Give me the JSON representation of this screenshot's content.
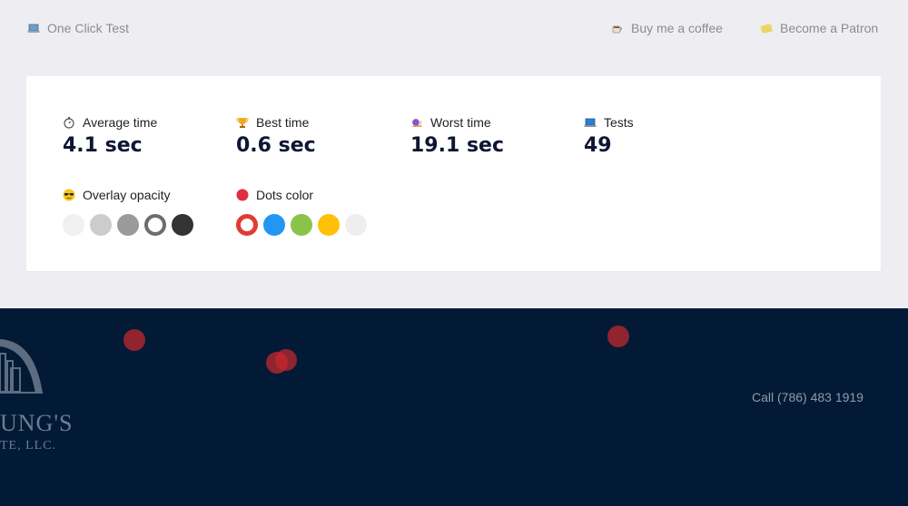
{
  "topbar": {
    "brand": {
      "label": "One Click Test",
      "icon": "laptop-icon"
    },
    "coffee": {
      "label": "Buy me a coffee",
      "icon": "coffee-icon"
    },
    "patron": {
      "label": "Become a Patron",
      "icon": "money-icon"
    }
  },
  "stats": {
    "average": {
      "label": "Average time",
      "value": "4.1 sec",
      "icon": "stopwatch-icon"
    },
    "best": {
      "label": "Best time",
      "value": "0.6 sec",
      "icon": "trophy-icon"
    },
    "worst": {
      "label": "Worst time",
      "value": "19.1 sec",
      "icon": "snail-icon"
    },
    "tests": {
      "label": "Tests",
      "value": "49",
      "icon": "laptop-icon"
    }
  },
  "options": {
    "overlay_opacity": {
      "label": "Overlay opacity",
      "icon": "sunglasses-face-icon",
      "swatches": [
        "#f0f0f0",
        "#cccccc",
        "#9a9a9a",
        "#6d6d6d",
        "#333333"
      ],
      "selected_index": 3
    },
    "dots_color": {
      "label": "Dots color",
      "icon": "red-circle-icon",
      "swatches": [
        "#e23b35",
        "#2196f3",
        "#8bc34a",
        "#ffc107",
        "#eeeeee"
      ],
      "selected_index": 0
    }
  },
  "site": {
    "logo_text_line1": "UNG'S",
    "logo_text_line2": "TE, LLC.",
    "call": "Call  (786) 483 1919"
  },
  "colors": {
    "page_bg": "#eeeef2",
    "panel_bg": "#ffffff",
    "site_bg": "#021a36",
    "dot": "#c8282d",
    "value_text": "#0d1633"
  }
}
